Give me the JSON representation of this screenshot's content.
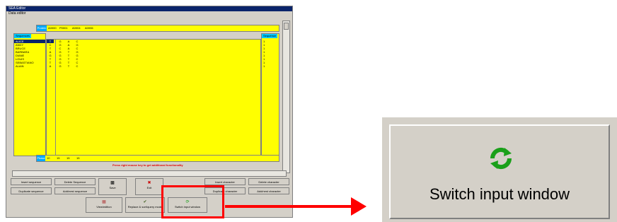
{
  "window": {
    "title": "SEA Editor",
    "menu": "Data editor"
  },
  "top_strip": {
    "label": "Protein",
    "cells": [
      "A0000",
      "P0001",
      "A0004",
      "A0006"
    ]
  },
  "left_panel": {
    "header": "Sequences",
    "names": [
      "ALICE",
      "ANDY",
      "BRUCE",
      "BARBARA",
      "DIANE",
      "LOUIS",
      "SEBASTIANO",
      "ALAIN"
    ]
  },
  "grid": {
    "rows": [
      [
        "T",
        "G",
        "A",
        "C"
      ],
      [
        "C",
        "G",
        "A",
        "G"
      ],
      [
        "T",
        "C",
        "A",
        "C"
      ],
      [
        "A",
        "G",
        "T",
        "G"
      ],
      [
        "G",
        "G",
        "T",
        "G"
      ],
      [
        "T",
        "G",
        "T",
        "C"
      ],
      [
        "T",
        "G",
        "T",
        "C"
      ],
      [
        "A",
        "G",
        "T",
        "C"
      ]
    ]
  },
  "right_panel": {
    "header": "Sequence",
    "values": [
      "1",
      "1",
      "1",
      "1",
      "1",
      "1",
      "1",
      "1"
    ]
  },
  "bottom_strip": {
    "label": "Phase",
    "cells": [
      "10",
      "15",
      "15",
      "15"
    ]
  },
  "hint": "Press right mouse key to get additional functionality",
  "buttons": {
    "insert_sequence": "Insert sequence",
    "delete_sequence": "Delete Sequence",
    "duplicate_sequence": "Duplicate sequence",
    "add_nest_sequence": "Add/nest sequence",
    "save": "Save",
    "exit": "Exit",
    "insert_character": "Insert character",
    "delete_character": "Delete character",
    "duplicate_character": "Duplicate character",
    "add_nest_character": "Add/nest character",
    "view_edition": "View/edition",
    "replace_sort": "Replace & sort/query mode",
    "switch_input_window": "Switch input window"
  },
  "zoom": {
    "label": "Switch input window"
  },
  "colors": {
    "highlight": "#ff0000",
    "grid": "#ffff00",
    "selection": "#0a246a",
    "icon_green": "#1aa01a"
  }
}
